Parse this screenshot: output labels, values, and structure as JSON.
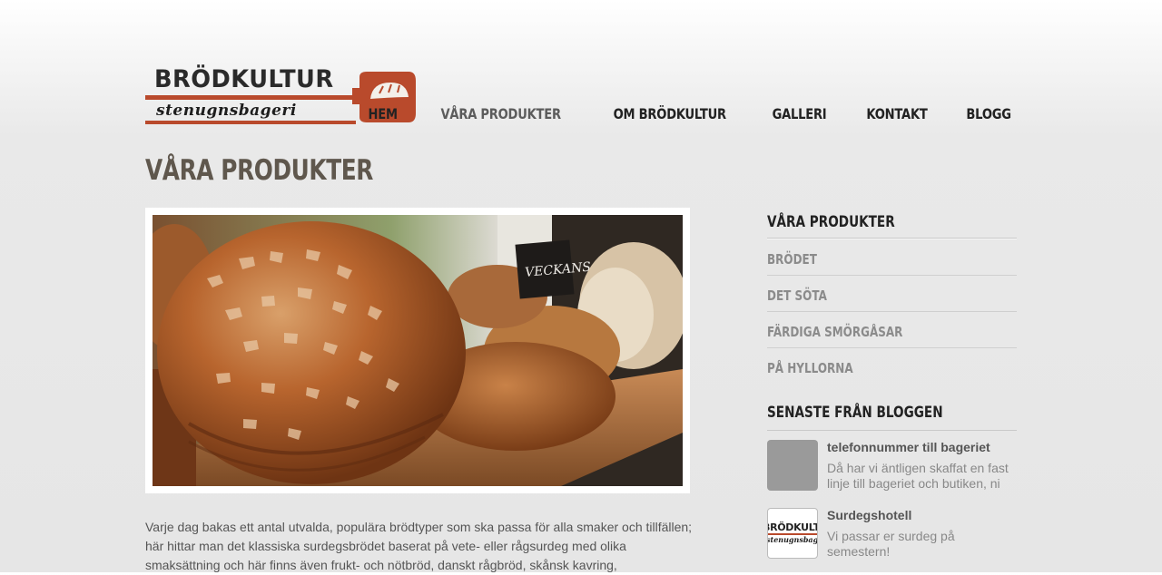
{
  "logo": {
    "word": "BRÖDKULTUR",
    "sub": "stenugnsbageri",
    "small_word": "BRÖDKULTUR",
    "small_sub": "stenugnsbageri"
  },
  "nav": [
    "HEM",
    "VÅRA PRODUKTER",
    "OM BRÖDKULTUR",
    "GALLERI",
    "KONTAKT",
    "BLOGG"
  ],
  "page_title": "VÅRA PRODUKTER",
  "hero": {
    "sign_text": "VECKANS"
  },
  "intro": "Varje dag bakas ett antal utvalda, populära brödtyper som ska passa för alla smaker och tillfällen; här hittar man det klassiska surdegsbrödet baserat på vete- eller rågsurdeg med olika smaksättning och här finns även frukt- och nötbröd, danskt rågbröd, skånsk kavring,",
  "sidebar": {
    "products_heading": "VÅRA PRODUKTER",
    "items": [
      "BRÖDET",
      "DET SÖTA",
      "FÄRDIGA SMÖRGÅSAR",
      "PÅ HYLLORNA"
    ],
    "blog_heading": "SENASTE FRÅN BLOGGEN",
    "posts": [
      {
        "title": "telefonnummer till bageriet",
        "excerpt": "Då har vi äntligen skaffat en fast linje till bageriet och butiken, ni"
      },
      {
        "title": "Surdegshotell",
        "excerpt": "Vi passar er surdeg på semestern!"
      }
    ]
  },
  "colors": {
    "brand_red": "#b94a2c",
    "heading": "#5f574d",
    "nav": "#222222"
  }
}
